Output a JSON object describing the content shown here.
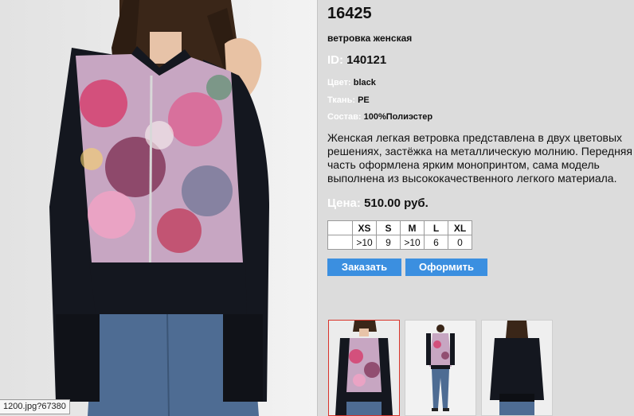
{
  "status_bar": {
    "text": "1200.jpg?67380"
  },
  "product": {
    "title": "16425",
    "subtitle": "ветровка женская",
    "id_label": "ID:",
    "id_value": "140121",
    "color_label": "Цвет:",
    "color_value": "black",
    "fabric_label": "Ткань:",
    "fabric_value": "PE",
    "composition_label": "Состав:",
    "composition_value": "100%Полиэстер",
    "description": "Женская легкая ветровка представлена в двух цветовых решениях, застёжка на металлическую молнию. Передняя часть оформлена ярким  монопринтом, сама модель выполнена из высококачественного легкого материала.",
    "price_label": "Цена:",
    "price_value": "510.00 руб."
  },
  "sizes": {
    "headers": [
      "XS",
      "S",
      "M",
      "L",
      "XL"
    ],
    "values": [
      ">10",
      "9",
      ">10",
      "6",
      "0"
    ]
  },
  "buttons": {
    "order": "Заказать",
    "checkout": "Оформить"
  },
  "colors": {
    "button": "#3b8fe0",
    "active_thumb_border": "#d9332a",
    "background": "#dcdcdc"
  }
}
